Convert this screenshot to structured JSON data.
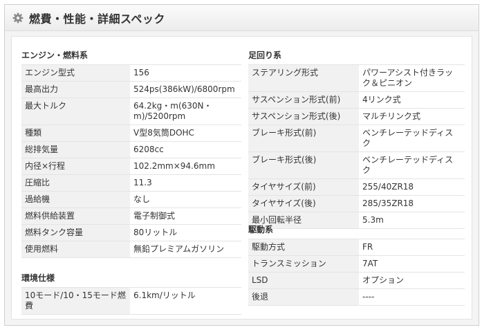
{
  "header": {
    "title": "燃費・性能・詳細スペック",
    "icon": "gear-icon"
  },
  "engine": {
    "title": "エンジン・燃料系",
    "rows": [
      {
        "label": "エンジン型式",
        "value": "156"
      },
      {
        "label": "最高出力",
        "value": "524ps(386kW)/6800rpm"
      },
      {
        "label": "最大トルク",
        "value": "64.2kg・m(630N・m)/5200rpm"
      },
      {
        "label": "種類",
        "value": "V型8気筒DOHC"
      },
      {
        "label": "総排気量",
        "value": "6208cc"
      },
      {
        "label": "内径×行程",
        "value": "102.2mm×94.6mm"
      },
      {
        "label": "圧縮比",
        "value": "11.3"
      },
      {
        "label": "過給機",
        "value": "なし"
      },
      {
        "label": "燃料供給装置",
        "value": "電子制御式"
      },
      {
        "label": "燃料タンク容量",
        "value": "80リットル"
      },
      {
        "label": "使用燃料",
        "value": "無鉛プレミアムガソリン"
      }
    ]
  },
  "environment": {
    "title": "環境仕様",
    "rows": [
      {
        "label": "10モード/10・15モード燃費",
        "value": "6.1km/リットル"
      }
    ]
  },
  "suspension": {
    "title": "足回り系",
    "rows": [
      {
        "label": "ステアリング形式",
        "value": "パワーアシスト付きラック＆ピニオン"
      },
      {
        "label": "サスペンション形式(前)",
        "value": "4リンク式"
      },
      {
        "label": "サスペンション形式(後)",
        "value": "マルチリンク式"
      },
      {
        "label": "ブレーキ形式(前)",
        "value": "ベンチレーテッドディスク"
      },
      {
        "label": "ブレーキ形式(後)",
        "value": "ベンチレーテッドディスク"
      },
      {
        "label": "タイヤサイズ(前)",
        "value": "255/40ZR18"
      },
      {
        "label": "タイヤサイズ(後)",
        "value": "285/35ZR18"
      },
      {
        "label": "最小回転半径",
        "value": "5.3m"
      }
    ]
  },
  "drivetrain": {
    "title": "駆動系",
    "rows": [
      {
        "label": "駆動方式",
        "value": "FR"
      },
      {
        "label": "トランスミッション",
        "value": "7AT"
      },
      {
        "label": "LSD",
        "value": "オプション"
      },
      {
        "label": "後退",
        "value": "----"
      }
    ]
  }
}
